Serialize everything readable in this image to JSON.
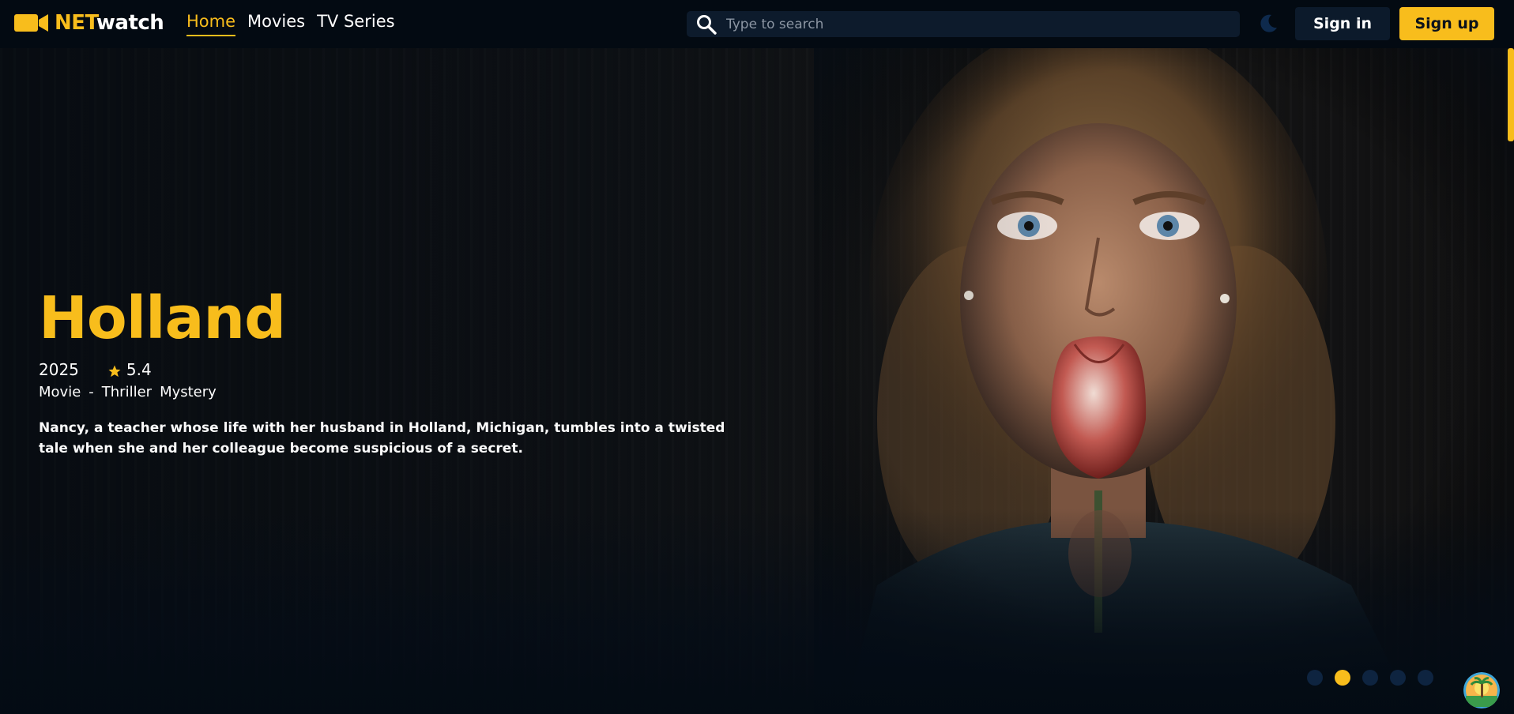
{
  "brand": {
    "net": "NET",
    "watch": "watch",
    "accent_color": "#f8bd1c"
  },
  "nav": {
    "links": [
      {
        "label": "Home",
        "active": true
      },
      {
        "label": "Movies",
        "active": false
      },
      {
        "label": "TV Series",
        "active": false
      }
    ]
  },
  "search": {
    "placeholder": "Type to search",
    "value": "",
    "icon": "search-icon"
  },
  "theme_toggle": {
    "icon": "moon-icon"
  },
  "auth": {
    "signin_label": "Sign in",
    "signup_label": "Sign up"
  },
  "hero": {
    "title": "Holland",
    "year": "2025",
    "rating": "5.4",
    "type": "Movie",
    "separator": "-",
    "genres": [
      "Thriller",
      "Mystery"
    ],
    "overview": "Nancy, a teacher whose life with her husband in Holland, Michigan, tumbles into a twisted tale when she and her colleague become suspicious of a secret."
  },
  "carousel": {
    "slide_count": 5,
    "active_index": 1
  },
  "colors": {
    "background": "#050d16",
    "navbar": "#030a12",
    "button_dark": "#0c1a2b",
    "dot_inactive": "#0e2440"
  }
}
